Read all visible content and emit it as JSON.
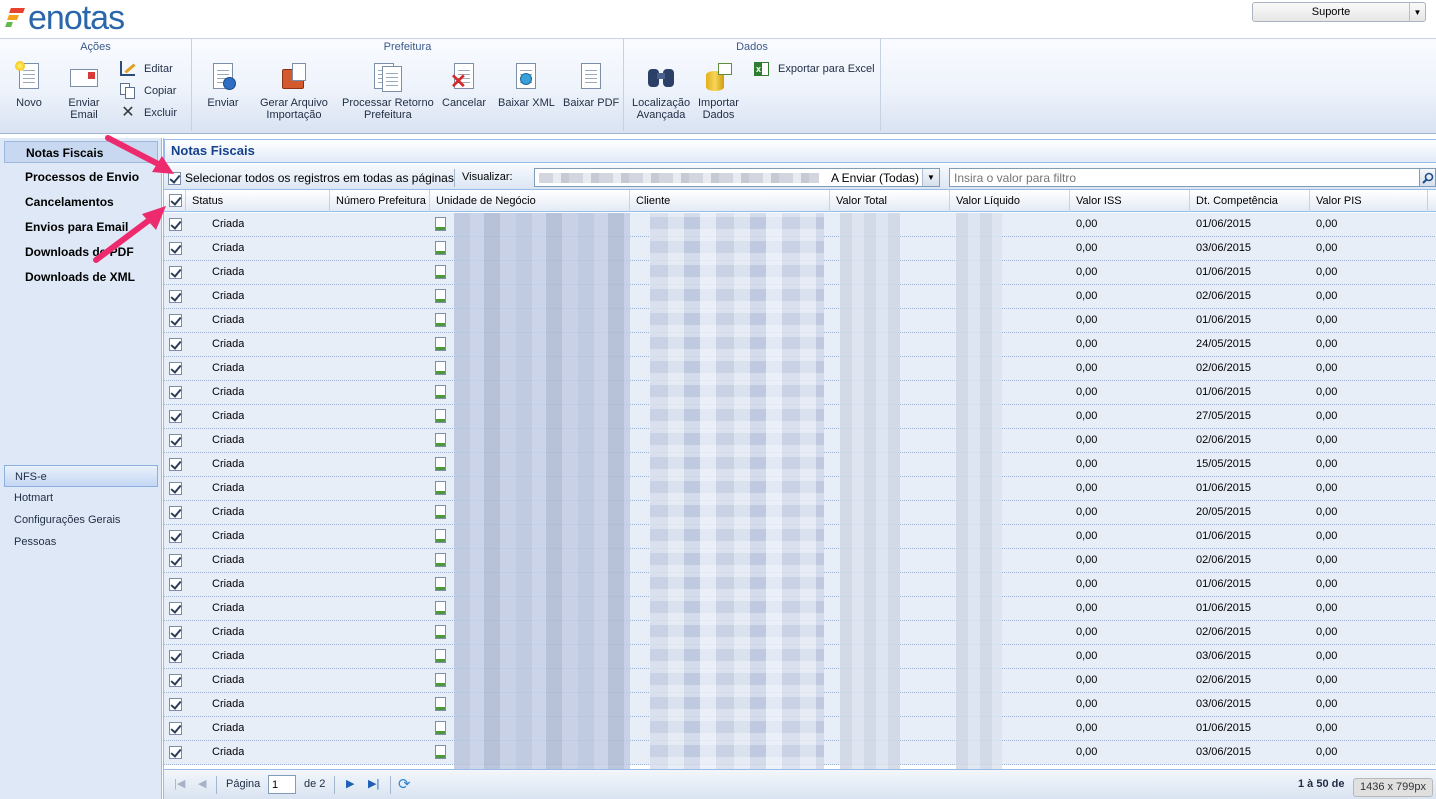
{
  "header": {
    "logo_text": "enotas",
    "support_label": "Suporte"
  },
  "ribbon": {
    "groups": [
      {
        "title": "Ações"
      },
      {
        "title": "Prefeitura"
      },
      {
        "title": "Dados"
      }
    ],
    "acoes": {
      "novo": "Novo",
      "enviar_email_1": "Enviar",
      "enviar_email_2": "Email",
      "editar": "Editar",
      "copiar": "Copiar",
      "excluir": "Excluir"
    },
    "prefeitura": {
      "enviar": "Enviar",
      "gerar_1": "Gerar Arquivo",
      "gerar_2": "Importação",
      "processar_1": "Processar Retorno",
      "processar_2": "Prefeitura",
      "cancelar": "Cancelar",
      "baixar_xml": "Baixar XML",
      "baixar_pdf": "Baixar PDF"
    },
    "dados": {
      "localizacao_1": "Localização",
      "localizacao_2": "Avançada",
      "importar_1": "Importar",
      "importar_2": "Dados",
      "exportar_excel": "Exportar para Excel"
    }
  },
  "leftnav": {
    "links": [
      "Notas Fiscais",
      "Processos de Envio",
      "Cancelamentos",
      "Envios para Email",
      "Downloads de PDF",
      "Downloads de XML"
    ],
    "modules": [
      "NFS-e",
      "Hotmart",
      "Configurações Gerais",
      "Pessoas"
    ]
  },
  "panel": {
    "title": "Notas Fiscais",
    "select_all_label": "Selecionar todos os registros em todas as páginas",
    "visualizar_label": "Visualizar:",
    "visualizar_value": "A Enviar (Todas)",
    "filter_placeholder": "Insira o valor para filtro"
  },
  "grid": {
    "columns": [
      "Status",
      "Número Prefeitura",
      "Unidade de Negócio",
      "Cliente",
      "Valor Total",
      "Valor Líquido",
      "Valor ISS",
      "Dt. Competência",
      "Valor PIS"
    ],
    "rows": [
      {
        "status": "Criada",
        "valor_iss": "0,00",
        "dt_competencia": "01/06/2015",
        "valor_pis": "0,00"
      },
      {
        "status": "Criada",
        "valor_iss": "0,00",
        "dt_competencia": "03/06/2015",
        "valor_pis": "0,00"
      },
      {
        "status": "Criada",
        "valor_iss": "0,00",
        "dt_competencia": "01/06/2015",
        "valor_pis": "0,00"
      },
      {
        "status": "Criada",
        "valor_iss": "0,00",
        "dt_competencia": "02/06/2015",
        "valor_pis": "0,00"
      },
      {
        "status": "Criada",
        "valor_iss": "0,00",
        "dt_competencia": "01/06/2015",
        "valor_pis": "0,00"
      },
      {
        "status": "Criada",
        "valor_iss": "0,00",
        "dt_competencia": "24/05/2015",
        "valor_pis": "0,00"
      },
      {
        "status": "Criada",
        "valor_iss": "0,00",
        "dt_competencia": "02/06/2015",
        "valor_pis": "0,00"
      },
      {
        "status": "Criada",
        "valor_iss": "0,00",
        "dt_competencia": "01/06/2015",
        "valor_pis": "0,00"
      },
      {
        "status": "Criada",
        "valor_iss": "0,00",
        "dt_competencia": "27/05/2015",
        "valor_pis": "0,00"
      },
      {
        "status": "Criada",
        "valor_iss": "0,00",
        "dt_competencia": "02/06/2015",
        "valor_pis": "0,00"
      },
      {
        "status": "Criada",
        "valor_iss": "0,00",
        "dt_competencia": "15/05/2015",
        "valor_pis": "0,00"
      },
      {
        "status": "Criada",
        "valor_iss": "0,00",
        "dt_competencia": "01/06/2015",
        "valor_pis": "0,00"
      },
      {
        "status": "Criada",
        "valor_iss": "0,00",
        "dt_competencia": "20/05/2015",
        "valor_pis": "0,00"
      },
      {
        "status": "Criada",
        "valor_iss": "0,00",
        "dt_competencia": "01/06/2015",
        "valor_pis": "0,00"
      },
      {
        "status": "Criada",
        "valor_iss": "0,00",
        "dt_competencia": "02/06/2015",
        "valor_pis": "0,00"
      },
      {
        "status": "Criada",
        "valor_iss": "0,00",
        "dt_competencia": "01/06/2015",
        "valor_pis": "0,00"
      },
      {
        "status": "Criada",
        "valor_iss": "0,00",
        "dt_competencia": "01/06/2015",
        "valor_pis": "0,00"
      },
      {
        "status": "Criada",
        "valor_iss": "0,00",
        "dt_competencia": "02/06/2015",
        "valor_pis": "0,00"
      },
      {
        "status": "Criada",
        "valor_iss": "0,00",
        "dt_competencia": "03/06/2015",
        "valor_pis": "0,00"
      },
      {
        "status": "Criada",
        "valor_iss": "0,00",
        "dt_competencia": "02/06/2015",
        "valor_pis": "0,00"
      },
      {
        "status": "Criada",
        "valor_iss": "0,00",
        "dt_competencia": "03/06/2015",
        "valor_pis": "0,00"
      },
      {
        "status": "Criada",
        "valor_iss": "0,00",
        "dt_competencia": "01/06/2015",
        "valor_pis": "0,00"
      },
      {
        "status": "Criada",
        "valor_iss": "0,00",
        "dt_competencia": "03/06/2015",
        "valor_pis": "0,00"
      }
    ]
  },
  "pager": {
    "page_label": "Página",
    "page_value": "1",
    "of_label": "de 2",
    "range_label": "1 à 50 de"
  },
  "overlay": {
    "dimensions": "1436 x 799px"
  },
  "colors": {
    "accent": "#15428b",
    "annotation_arrow": "#ee2a6e",
    "logo_blue": "#2a66a9"
  }
}
